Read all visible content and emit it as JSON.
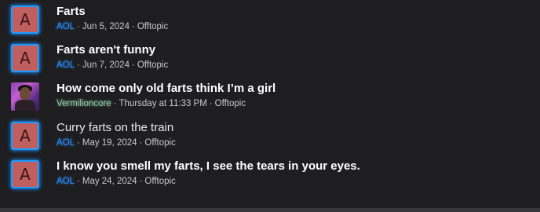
{
  "threads": [
    {
      "title": "Farts",
      "author": "AOL",
      "date": "Jun 5, 2024",
      "forum": "Offtopic",
      "avatar_letter": "A",
      "title_bold": true
    },
    {
      "title": "Farts aren't funny",
      "author": "AOL",
      "date": "Jun 7, 2024",
      "forum": "Offtopic",
      "avatar_letter": "A",
      "title_bold": true
    },
    {
      "title": "How come only old farts think I’m a girl",
      "author": "Vermilioncore",
      "date": "Thursday at 11:33 PM",
      "forum": "Offtopic",
      "avatar_letter": "",
      "title_bold": true
    },
    {
      "title": "Curry farts on the train",
      "author": "AOL",
      "date": "May 19, 2024",
      "forum": "Offtopic",
      "avatar_letter": "A",
      "title_bold": false
    },
    {
      "title": "I know you smell my farts, I see the tears in your eyes.",
      "author": "AOL",
      "date": "May 24, 2024",
      "forum": "Offtopic",
      "avatar_letter": "A",
      "title_bold": true
    }
  ],
  "separator": "·",
  "colors": {
    "background": "#1e1e20",
    "title": "#ffffff",
    "meta": "#c9c9c9",
    "author_blue": "#2a8dfb",
    "author_green": "#8fc9a4",
    "avatar_red": "#c05f5f",
    "avatar_glow": "#1a9bff"
  }
}
